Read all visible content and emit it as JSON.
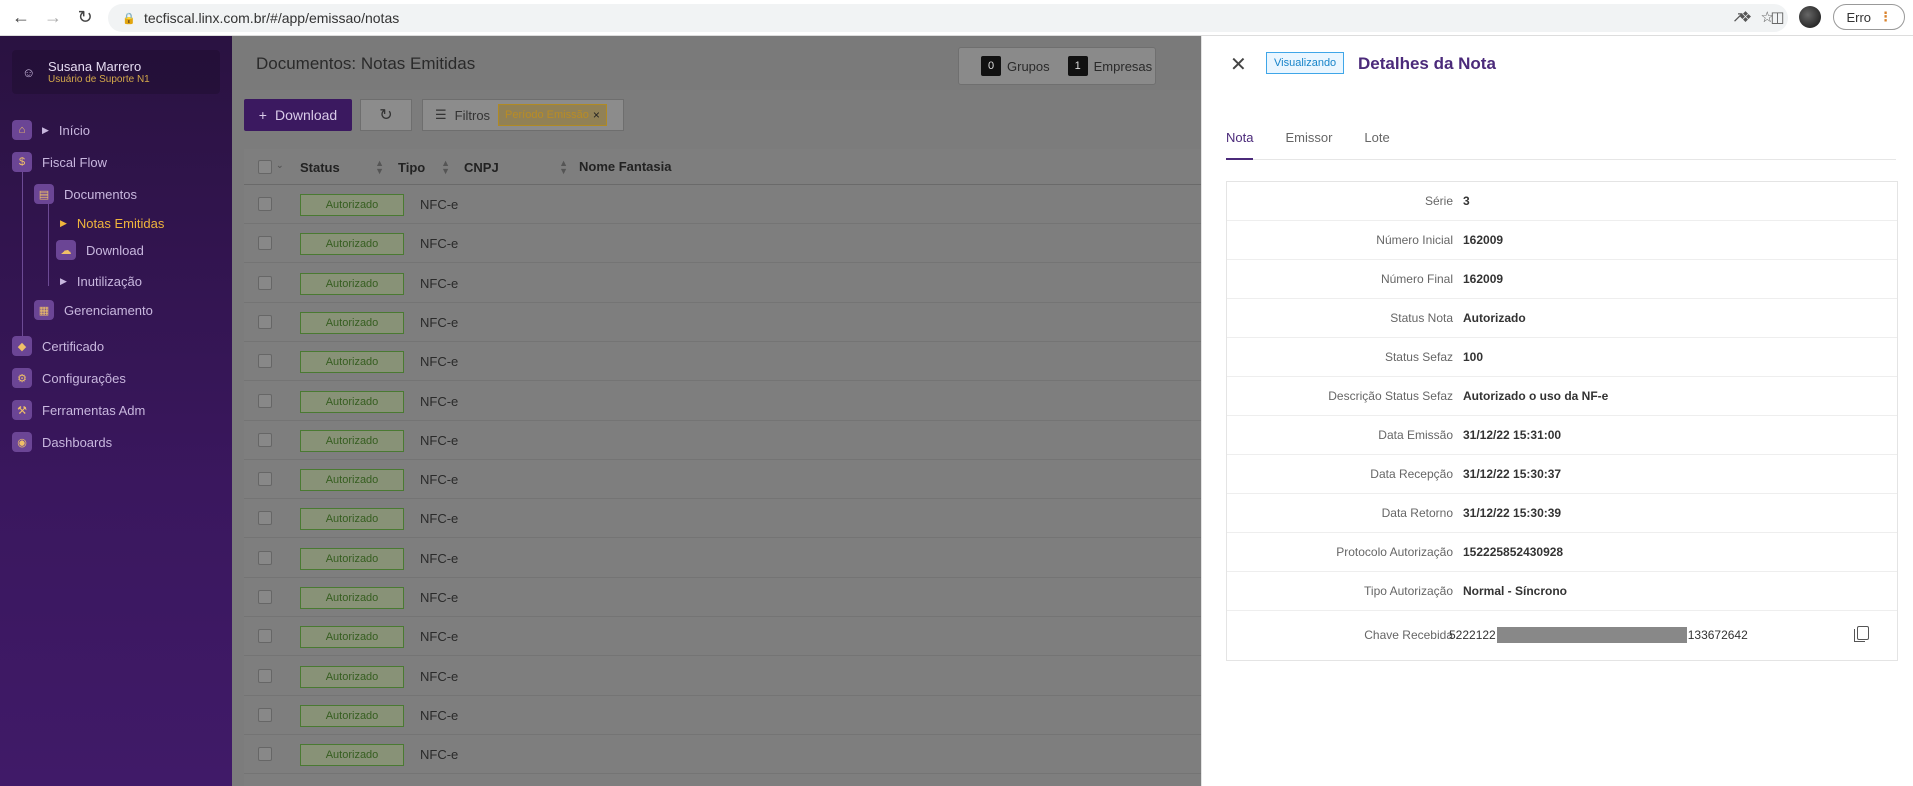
{
  "browser": {
    "url": "tecfiscal.linx.com.br/#/app/emissao/notas",
    "profile_label": "Erro"
  },
  "sidebar": {
    "user": {
      "name": "Susana Marrero",
      "role": "Usuário de Suporte N1"
    },
    "menu": {
      "inicio": "Início",
      "fiscal_flow": "Fiscal Flow",
      "documentos": "Documentos",
      "notas_emitidas": "Notas Emitidas",
      "download": "Download",
      "inutilizacao": "Inutilização",
      "gerenciamento": "Gerenciamento",
      "certificado": "Certificado",
      "configuracoes": "Configurações",
      "ferramentas_adm": "Ferramentas Adm",
      "dashboards": "Dashboards"
    }
  },
  "main": {
    "title": "Documentos: Notas Emitidas",
    "badges": {
      "grupos_count": "0",
      "grupos_label": "Grupos",
      "empresas_count": "1",
      "empresas_label": "Empresas"
    },
    "toolbar": {
      "download_label": "Download",
      "filters_label": "Filtros",
      "chip_label": "Período Emissão"
    },
    "table": {
      "columns": [
        "Status",
        "Tipo",
        "CNPJ",
        "Nome Fantasia"
      ],
      "rows": [
        {
          "status": "Autorizado",
          "tipo": "NFC-e"
        },
        {
          "status": "Autorizado",
          "tipo": "NFC-e"
        },
        {
          "status": "Autorizado",
          "tipo": "NFC-e"
        },
        {
          "status": "Autorizado",
          "tipo": "NFC-e"
        },
        {
          "status": "Autorizado",
          "tipo": "NFC-e"
        },
        {
          "status": "Autorizado",
          "tipo": "NFC-e"
        },
        {
          "status": "Autorizado",
          "tipo": "NFC-e"
        },
        {
          "status": "Autorizado",
          "tipo": "NFC-e"
        },
        {
          "status": "Autorizado",
          "tipo": "NFC-e"
        },
        {
          "status": "Autorizado",
          "tipo": "NFC-e"
        },
        {
          "status": "Autorizado",
          "tipo": "NFC-e"
        },
        {
          "status": "Autorizado",
          "tipo": "NFC-e"
        },
        {
          "status": "Autorizado",
          "tipo": "NFC-e"
        },
        {
          "status": "Autorizado",
          "tipo": "NFC-e"
        },
        {
          "status": "Autorizado",
          "tipo": "NFC-e"
        }
      ]
    }
  },
  "drawer": {
    "tag": "Visualizando",
    "title": "Detalhes da Nota",
    "tabs": [
      "Nota",
      "Emissor",
      "Lote"
    ],
    "fields": [
      {
        "label": "Série",
        "value": "3"
      },
      {
        "label": "Número Inicial",
        "value": "162009"
      },
      {
        "label": "Número Final",
        "value": "162009"
      },
      {
        "label": "Status Nota",
        "value": "Autorizado"
      },
      {
        "label": "Status Sefaz",
        "value": "100"
      },
      {
        "label": "Descrição Status Sefaz",
        "value": "Autorizado o uso da NF-e"
      },
      {
        "label": "Data Emissão",
        "value": "31/12/22 15:31:00"
      },
      {
        "label": "Data Recepção",
        "value": "31/12/22 15:30:37"
      },
      {
        "label": "Data Retorno",
        "value": "31/12/22 15:30:39"
      },
      {
        "label": "Protocolo Autorização",
        "value": "152225852430928"
      },
      {
        "label": "Tipo Autorização",
        "value": "Normal - Síncrono"
      }
    ],
    "chave": {
      "label": "Chave Recebida",
      "prefix": "5222122",
      "suffix": "133672642"
    }
  },
  "colors": {
    "sidebar_bg": "#3a175e",
    "accent_purple": "#4b2a7a",
    "active_menu": "#f0b53c",
    "tag_blue": "#1884c9"
  }
}
